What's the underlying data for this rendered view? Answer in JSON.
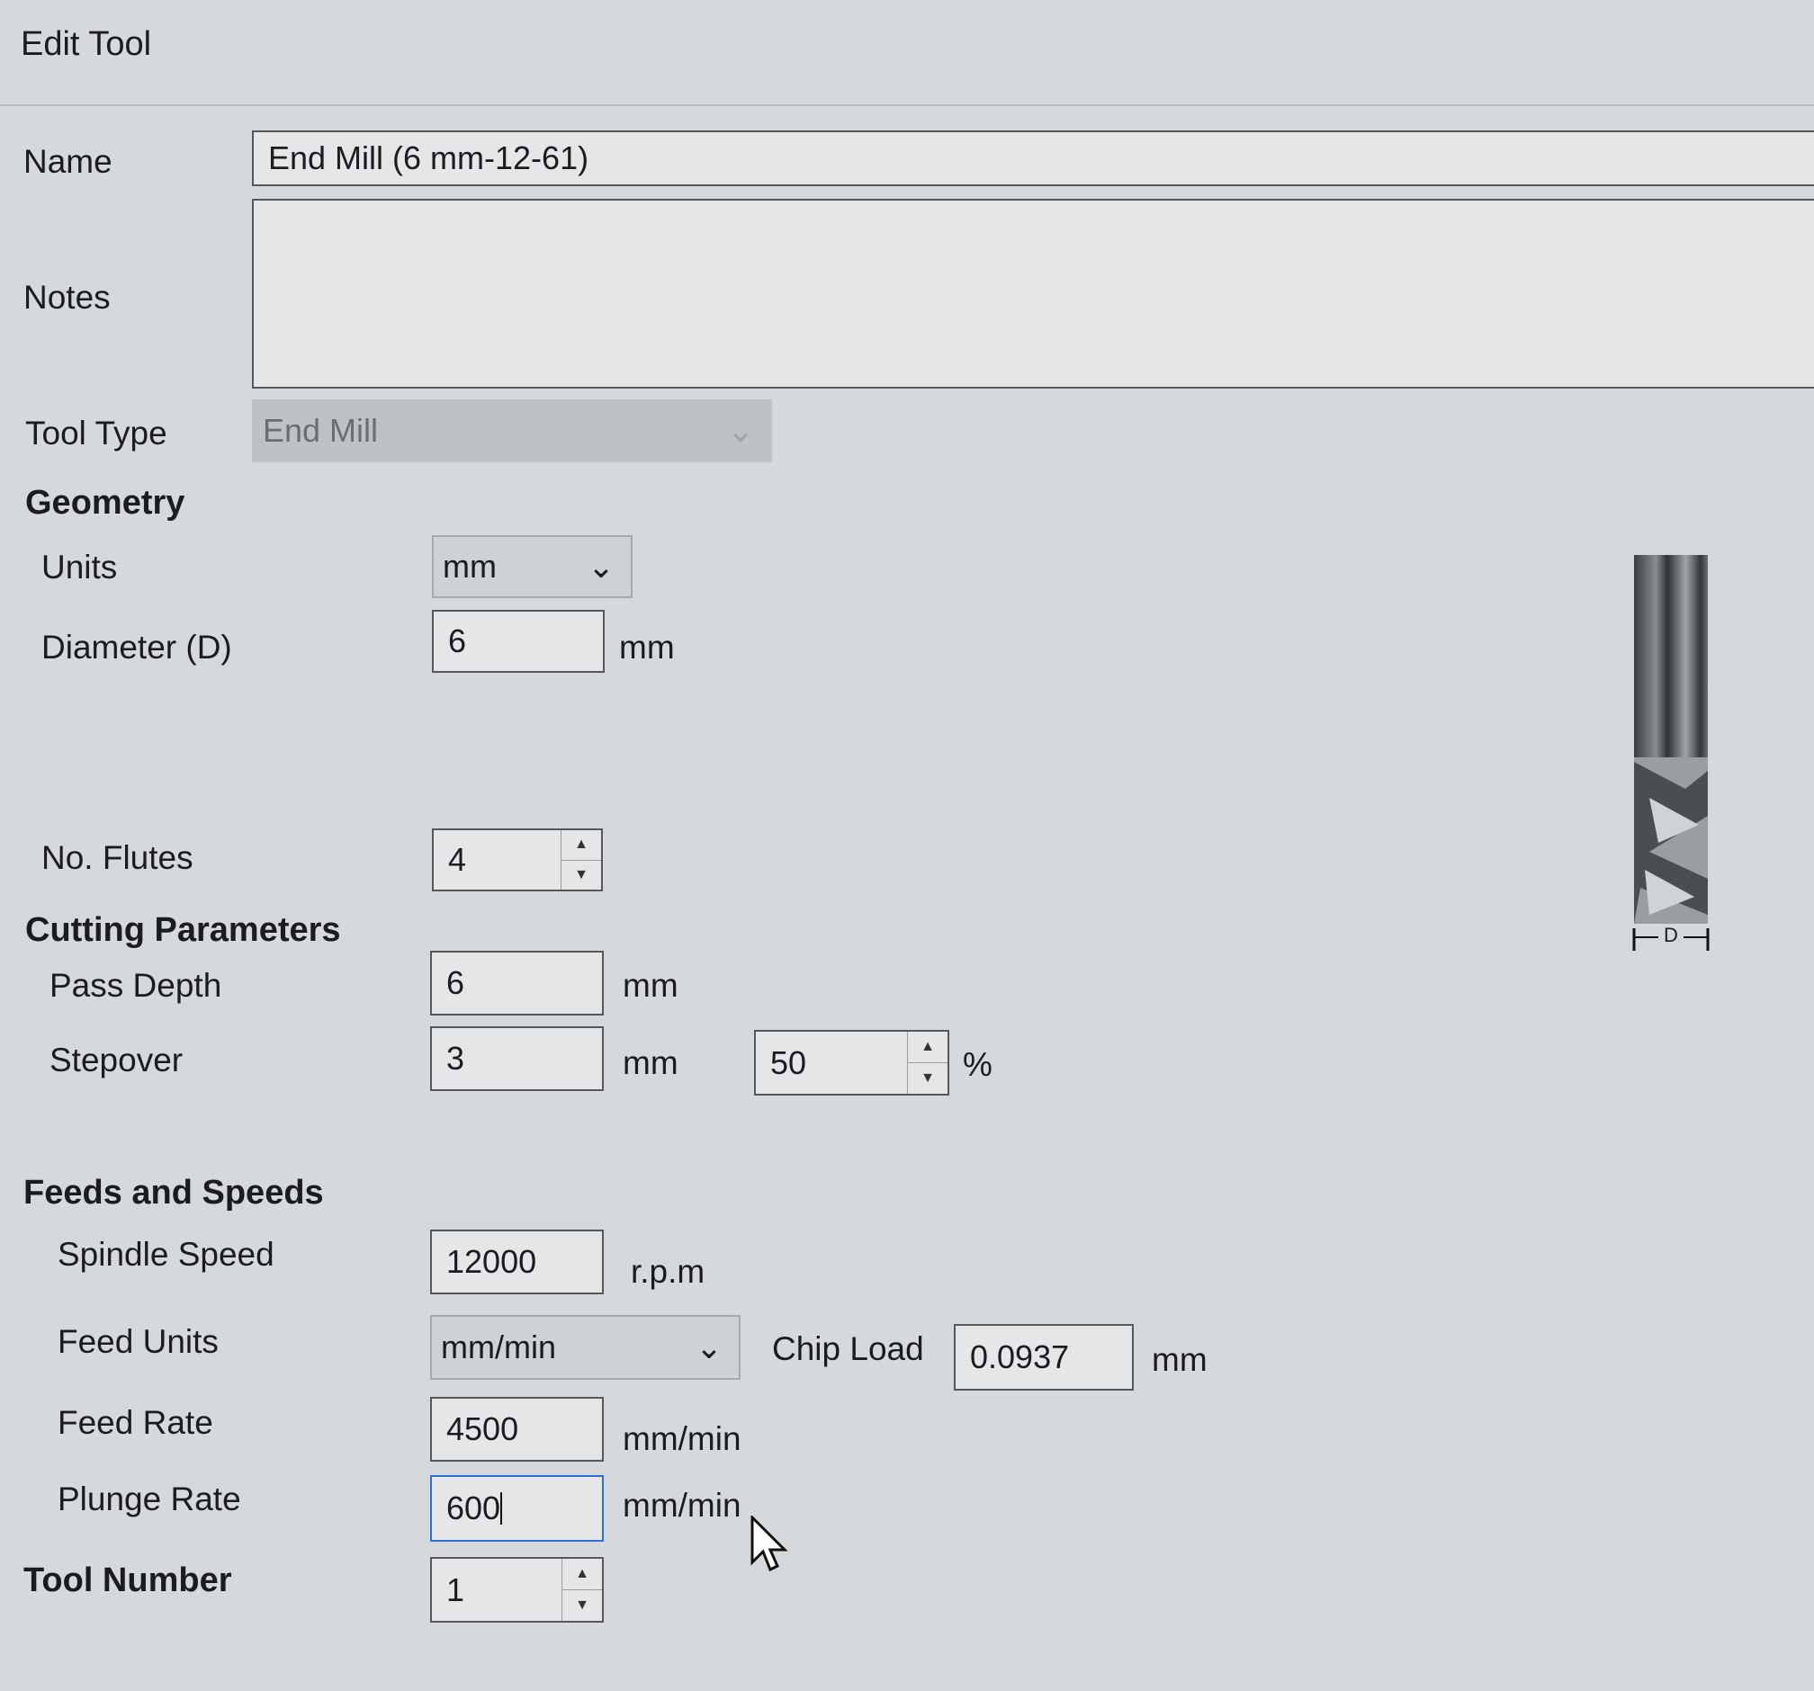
{
  "window": {
    "title": "Edit Tool"
  },
  "name": {
    "label": "Name",
    "value": "End Mill (6 mm-12-61)"
  },
  "notes": {
    "label": "Notes",
    "value": ""
  },
  "tool_type": {
    "label": "Tool Type",
    "value": "End Mill"
  },
  "geometry": {
    "heading": "Geometry",
    "units": {
      "label": "Units",
      "value": "mm"
    },
    "diameter": {
      "label": "Diameter (D)",
      "value": "6",
      "unit": "mm"
    },
    "flutes": {
      "label": "No. Flutes",
      "value": "4"
    },
    "diagram_label": "D"
  },
  "cutting": {
    "heading": "Cutting Parameters",
    "pass_depth": {
      "label": "Pass Depth",
      "value": "6",
      "unit": "mm"
    },
    "stepover": {
      "label": "Stepover",
      "value": "3",
      "unit": "mm",
      "percent": "50",
      "percent_unit": "%"
    }
  },
  "feeds": {
    "heading": "Feeds and Speeds",
    "spindle_speed": {
      "label": "Spindle Speed",
      "value": "12000",
      "unit": "r.p.m"
    },
    "feed_units": {
      "label": "Feed Units",
      "value": "mm/min"
    },
    "chip_load": {
      "label": "Chip Load",
      "value": "0.0937",
      "unit": "mm"
    },
    "feed_rate": {
      "label": "Feed Rate",
      "value": "4500",
      "unit": "mm/min"
    },
    "plunge_rate": {
      "label": "Plunge Rate",
      "value": "600",
      "unit": "mm/min"
    }
  },
  "tool_number": {
    "label": "Tool Number",
    "value": "1"
  }
}
